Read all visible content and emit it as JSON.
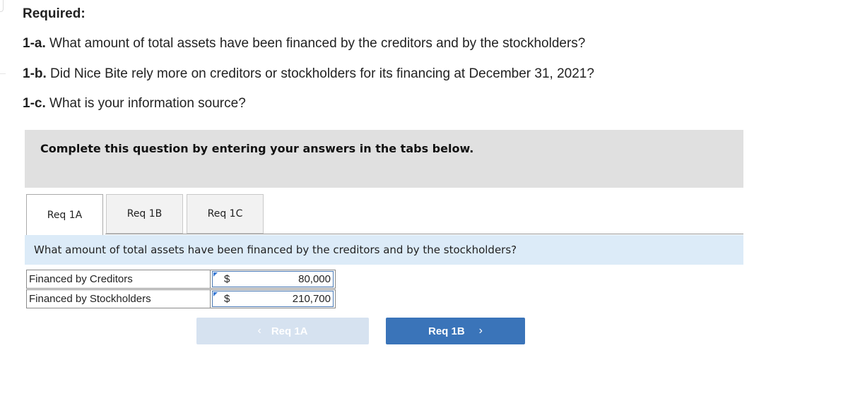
{
  "required": {
    "title": "Required:",
    "questions": [
      {
        "num": "1-a.",
        "text": " What amount of total assets have been financed by the creditors and by the stockholders?"
      },
      {
        "num": "1-b.",
        "text": " Did Nice Bite rely more on creditors or stockholders for its financing at December 31, 2021?"
      },
      {
        "num": "1-c.",
        "text": " What is your information source?"
      }
    ]
  },
  "banner": {
    "text": "Complete this question by entering your answers in the tabs below."
  },
  "tabs": [
    {
      "label": "Req 1A",
      "active": true
    },
    {
      "label": "Req 1B",
      "active": false
    },
    {
      "label": "Req 1C",
      "active": false
    }
  ],
  "prompt": "What amount of total assets have been financed by the creditors and by the stockholders?",
  "table": {
    "rows": [
      {
        "label": "Financed by Creditors",
        "currency": "$",
        "value": "80,000"
      },
      {
        "label": "Financed by Stockholders",
        "currency": "$",
        "value": "210,700"
      }
    ]
  },
  "nav": {
    "prev_label": "Req 1A",
    "prev_icon": "‹",
    "next_label": "Req 1B",
    "next_icon": "›"
  },
  "colors": {
    "next_button": "#3a74b9",
    "prev_button_disabled": "#d6e2f0",
    "prompt_bg": "#dcebf8",
    "banner_bg": "#e0e0e0"
  }
}
